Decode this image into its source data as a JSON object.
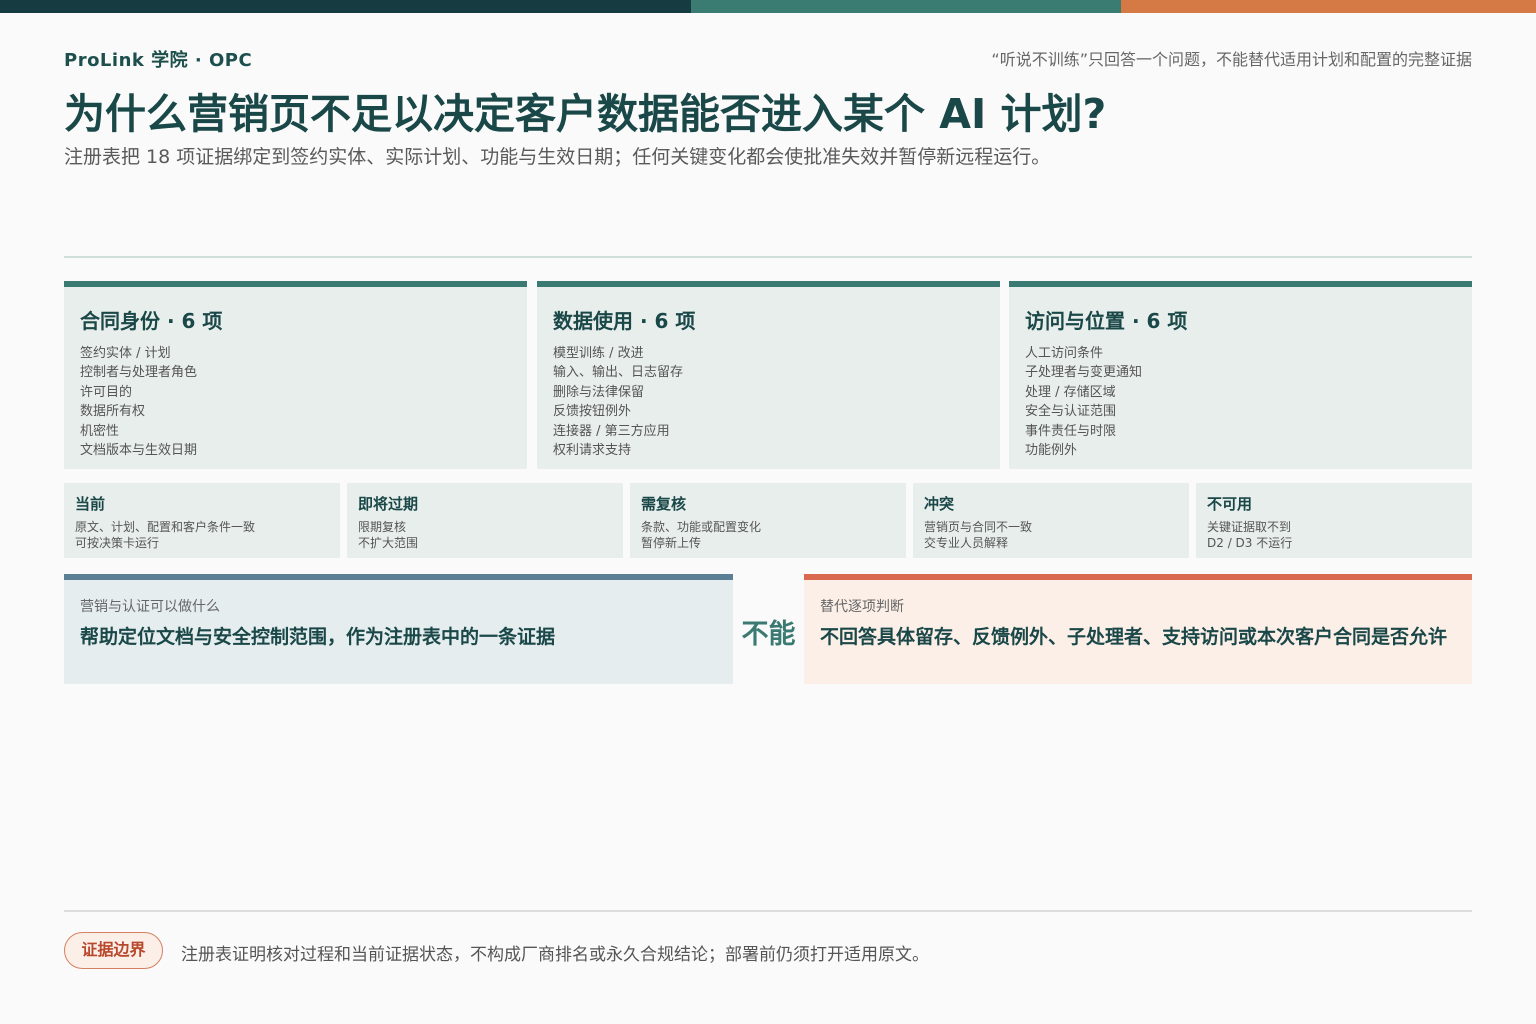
{
  "brand": "ProLink 学院 · OPC",
  "top_note": "“听说不训练”只回答一个问题，不能替代适用计划和配置的完整证据",
  "title": "为什么营销页不足以决定客户数据能否进入某个 AI 计划?",
  "subtitle": "注册表把 18 项证据绑定到签约实体、实际计划、功能与生效日期；任何关键变化都会使批准失效并暂停新远程运行。",
  "colors": {
    "strip_dark": "#163c42",
    "strip_teal": "#3a7b72",
    "strip_orange": "#d57a44",
    "accent_teal": "#3b7a72",
    "accent_blue": "#5b7f95",
    "accent_red": "#d9694f"
  },
  "categories": [
    {
      "title": "合同身份 · 6 项",
      "items": [
        "签约实体 / 计划",
        "控制者与处理者角色",
        "许可目的",
        "数据所有权",
        "机密性",
        "文档版本与生效日期"
      ]
    },
    {
      "title": "数据使用 · 6 项",
      "items": [
        "模型训练 / 改进",
        "输入、输出、日志留存",
        "删除与法律保留",
        "反馈按钮例外",
        "连接器 / 第三方应用",
        "权利请求支持"
      ]
    },
    {
      "title": "访问与位置 · 6 项",
      "items": [
        "人工访问条件",
        "子处理者与变更通知",
        "处理 / 存储区域",
        "安全与认证范围",
        "事件责任与时限",
        "功能例外"
      ]
    }
  ],
  "statuses": [
    {
      "title": "当前",
      "lines": [
        "原文、计划、配置和客户条件一致",
        "可按决策卡运行"
      ]
    },
    {
      "title": "即将过期",
      "lines": [
        "限期复核",
        "不扩大范围"
      ]
    },
    {
      "title": "需复核",
      "lines": [
        "条款、功能或配置变化",
        "暂停新上传"
      ]
    },
    {
      "title": "冲突",
      "lines": [
        "营销页与合同不一致",
        "交专业人员解释"
      ]
    },
    {
      "title": "不可用",
      "lines": [
        "关键证据取不到",
        "D2 / D3 不运行"
      ]
    }
  ],
  "compare": {
    "can_label": "营销与认证可以做什么",
    "can_text": "帮助定位文档与安全控制范围，作为注册表中的一条证据",
    "vs": "不能",
    "cannot_label": "替代逐项判断",
    "cannot_text": "不回答具体留存、反馈例外、子处理者、支持访问或本次客户合同是否允许"
  },
  "footer": {
    "pill": "证据边界",
    "note": "注册表证明核对过程和当前证据状态，不构成厂商排名或永久合规结论；部署前仍须打开适用原文。"
  }
}
